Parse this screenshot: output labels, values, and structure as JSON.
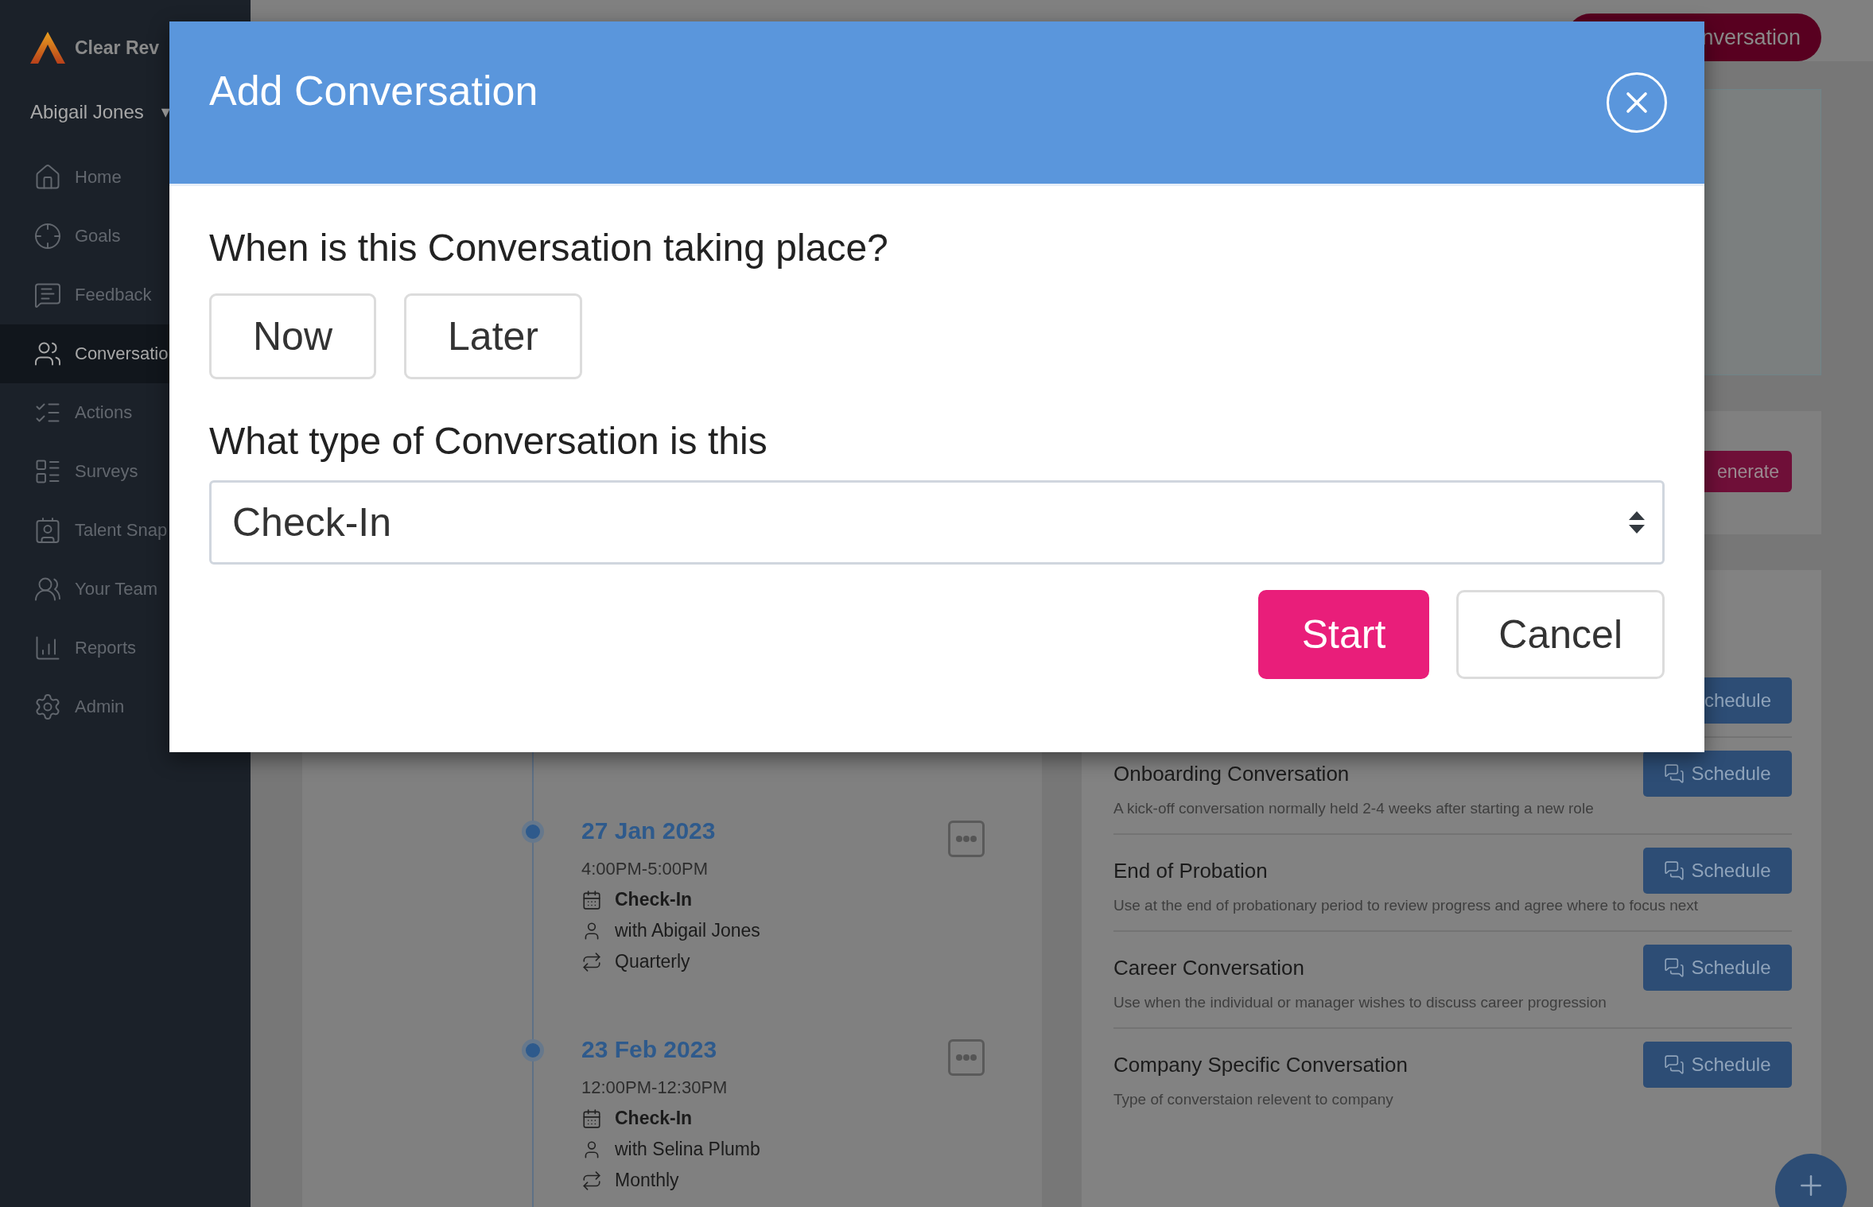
{
  "sidebar": {
    "brand": "Clear Rev",
    "user": "Abigail Jones",
    "user_caret": "▾",
    "items": [
      {
        "label": "Home",
        "selected": false
      },
      {
        "label": "Goals",
        "selected": false
      },
      {
        "label": "Feedback",
        "selected": false
      },
      {
        "label": "Conversatio",
        "selected": true
      },
      {
        "label": "Actions",
        "selected": false
      },
      {
        "label": "Surveys",
        "selected": false
      },
      {
        "label": "Talent Snap",
        "selected": false
      },
      {
        "label": "Your Team",
        "selected": false
      },
      {
        "label": "Reports",
        "selected": false
      },
      {
        "label": "Admin",
        "selected": false
      }
    ]
  },
  "header": {
    "action_button": "nversation"
  },
  "generate_button": "enerate",
  "timeline": [
    {
      "date": "27 Jan 2023",
      "time": "4:00PM-5:00PM",
      "type": "Check-In",
      "with": "with Abigail Jones",
      "frequency": "Quarterly"
    },
    {
      "date": "23 Feb 2023",
      "time": "12:00PM-12:30PM",
      "type": "Check-In",
      "with": "with Selina Plumb",
      "frequency": "Monthly"
    }
  ],
  "conversation_types": {
    "partial_button": "chedule",
    "items": [
      {
        "title": "Onboarding Conversation",
        "description": "A kick-off conversation normally held 2-4 weeks after starting a new role",
        "button": "Schedule"
      },
      {
        "title": "End of Probation",
        "description": "Use at the end of probationary period to review progress and agree where to focus next",
        "button": "Schedule"
      },
      {
        "title": "Career Conversation",
        "description": "Use when the individual or manager wishes to discuss career progression",
        "button": "Schedule"
      },
      {
        "title": "Company Specific Conversation",
        "description": "Type of converstaion relevent to company",
        "button": "Schedule"
      }
    ]
  },
  "dialog": {
    "title": "Add Conversation",
    "question_when": "When is this Conversation taking place?",
    "when_options": [
      {
        "label": "Now",
        "selected": false
      },
      {
        "label": "Later",
        "selected": false
      }
    ],
    "question_type": "What type of Conversation is this",
    "type_value": "Check-In",
    "buttons": [
      {
        "label": "Start",
        "kind": "primary"
      },
      {
        "label": "Cancel",
        "kind": "secondary"
      }
    ]
  }
}
